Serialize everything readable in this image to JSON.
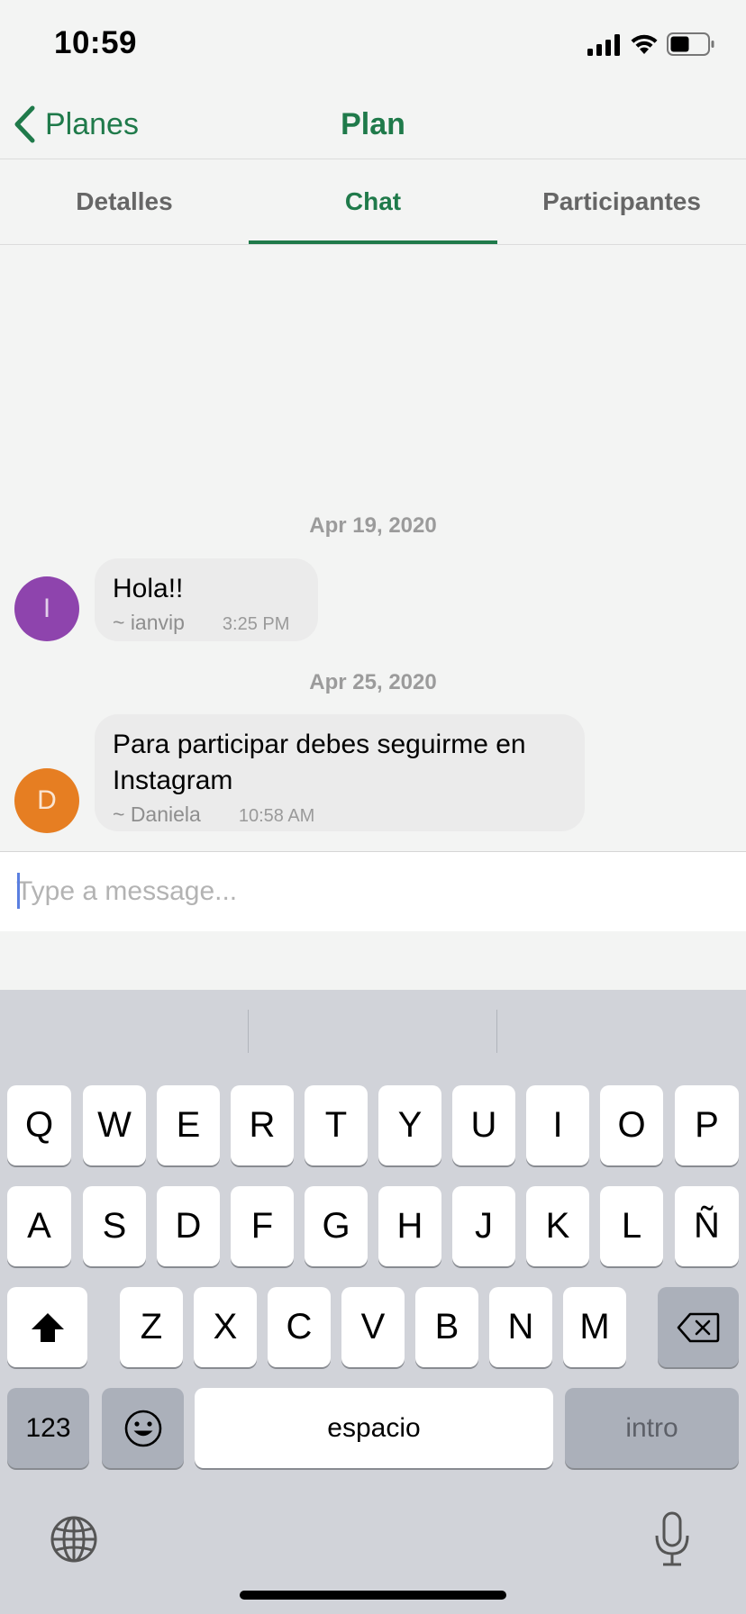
{
  "status": {
    "time": "10:59"
  },
  "nav": {
    "back_label": "Planes",
    "title": "Plan"
  },
  "tabs": [
    {
      "label": "Detalles",
      "active": false
    },
    {
      "label": "Chat",
      "active": true
    },
    {
      "label": "Participantes",
      "active": false
    }
  ],
  "chat": {
    "groups": [
      {
        "date": "Apr 19, 2020",
        "message": {
          "initial": "I",
          "avatar_color": "#8e44ad",
          "text": "Hola!!",
          "author": "~ ianvip",
          "time": "3:25 PM"
        }
      },
      {
        "date": "Apr 25, 2020",
        "message": {
          "initial": "D",
          "avatar_color": "#e67e22",
          "text": "Para participar debes seguirme en Instagram",
          "author": "~ Daniela",
          "time": "10:58 AM"
        }
      }
    ]
  },
  "composer": {
    "placeholder": "Type a message..."
  },
  "keyboard": {
    "row1": [
      "Q",
      "W",
      "E",
      "R",
      "T",
      "Y",
      "U",
      "I",
      "O",
      "P"
    ],
    "row2": [
      "A",
      "S",
      "D",
      "F",
      "G",
      "H",
      "J",
      "K",
      "L",
      "Ñ"
    ],
    "row3": [
      "Z",
      "X",
      "C",
      "V",
      "B",
      "N",
      "M"
    ],
    "numbers_label": "123",
    "space_label": "espacio",
    "return_label": "intro"
  },
  "colors": {
    "accent": "#1f7a4a"
  }
}
